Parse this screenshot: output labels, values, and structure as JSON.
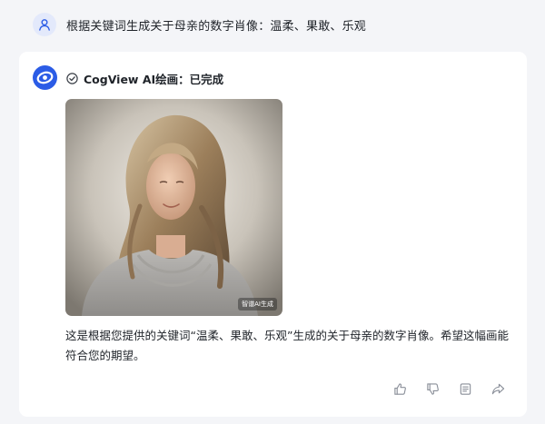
{
  "user_message": {
    "avatar_icon": "user-icon",
    "text": "根据关键词生成关于母亲的数字肖像：温柔、果敢、乐观"
  },
  "bot_message": {
    "logo_icon": "cogview-logo",
    "status_icon": "check-circle-icon",
    "status_text": "CogView AI绘画：已完成",
    "image": {
      "badge": "智谱AI生成",
      "alt": "Digital portrait of a woman with long wavy hair in a grey draped top"
    },
    "reply_text": "这是根据您提供的关键词“温柔、果敢、乐观”生成的关于母亲的数字肖像。希望这幅画能符合您的期望。",
    "actions": [
      {
        "name": "thumbs-up-icon"
      },
      {
        "name": "thumbs-down-icon"
      },
      {
        "name": "copy-icon"
      },
      {
        "name": "share-icon"
      }
    ]
  },
  "colors": {
    "page_background": "#f4f5f8",
    "card_background": "#ffffff",
    "accent_blue": "#2b5ce6",
    "icon_grey": "#8a8f99"
  }
}
